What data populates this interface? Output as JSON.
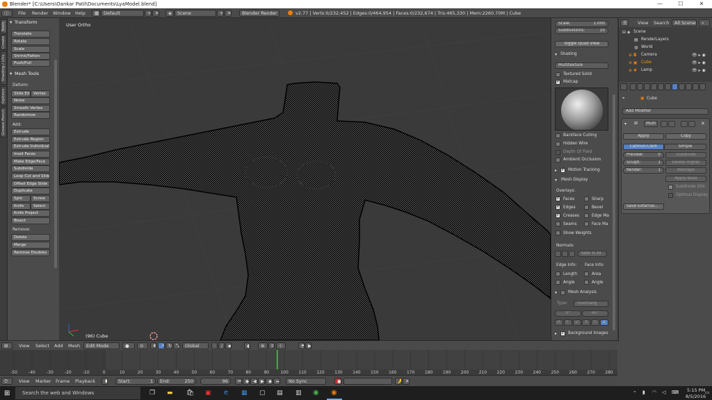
{
  "window": {
    "title": "Blender* [C:\\Users\\Oankar Patil\\Documents\\LyaModel.blend]"
  },
  "menu": {
    "items": [
      "File",
      "Render",
      "Window",
      "Help"
    ]
  },
  "header": {
    "layout": "Default",
    "scene": "Scene",
    "engine": "Blender Render",
    "stats": "v2.77 | Verts:0/232,452 | Edges:0/464,954 | Faces:0/232,674 | Tris:465,330 | Mem:2260.70M | Cube"
  },
  "tool_tabs": [
    "Tools",
    "Create",
    "Shading / UVs",
    "Options",
    "Grease Pencil"
  ],
  "toolshelf": {
    "transform": {
      "title": "Transform",
      "buttons": [
        "Translate",
        "Rotate",
        "Scale",
        "Shrink/Fatten",
        "Push/Pull"
      ]
    },
    "mesh_tools": {
      "title": "Mesh Tools",
      "deform_label": "Deform:",
      "deform": [
        "Slide Ed",
        "Vertex",
        "Noise",
        "Smooth Vertex",
        "Randomize"
      ],
      "add_label": "Add:",
      "add": [
        "Extrude",
        "Extrude Region",
        "Extrude Individual",
        "Inset Faces",
        "Make Edge/Face",
        "Subdivide",
        "Loop Cut and Slide",
        "Offset Edge Slide",
        "Duplicate",
        "Spin",
        "Screw",
        "Knife",
        "Select",
        "Knife Project",
        "Bisect"
      ],
      "remove_label": "Remove:",
      "remove": [
        "Delete",
        "Merge",
        "Remove Doubles"
      ]
    }
  },
  "viewport": {
    "view_label": "User Ortho",
    "object_label": "(96) Cube"
  },
  "npanel": {
    "scale_label": "Scale:",
    "scale_value": "1.000",
    "subdiv_label": "Subdivisions:",
    "subdiv_value": "10",
    "quad_view": "Toggle Quad View",
    "shading_title": "Shading",
    "shading_mode": "Multitexture",
    "textured_solid": "Textured Solid",
    "matcap": "Matcap",
    "backface_culling": "Backface Culling",
    "hidden_wire": "Hidden Wire",
    "depth_of_field": "Depth Of Field",
    "ambient_occlusion": "Ambient Occlusion",
    "motion_tracking": "Motion Tracking",
    "mesh_display_title": "Mesh Display",
    "overlays_label": "Overlays:",
    "overlays": [
      "Faces",
      "Sharp",
      "Edges",
      "Bevel",
      "Creases",
      "Edge Ma",
      "Seams",
      "Face Ma"
    ],
    "show_weights": "Show Weights",
    "normals_label": "Normals:",
    "normal_size": "Size: 0.10",
    "edge_info_label": "Edge Info:",
    "face_info_label": "Face Info:",
    "edge_info": [
      "Length",
      "Angle"
    ],
    "face_info": [
      "Area",
      "Angle"
    ],
    "mesh_analysis": "Mesh Analysis",
    "type_label": "Type:",
    "type_value": "Overhang",
    "angle_min": "0°",
    "angle_max": "45°",
    "axes": [
      "-X",
      "-Y",
      "-Z",
      "X",
      "Y",
      "Z"
    ],
    "background_images": "Background Images"
  },
  "outliner": {
    "menu": [
      "View",
      "Search",
      "All Scenes"
    ],
    "items": [
      "Scene",
      "RenderLayers",
      "World",
      "Camera",
      "Cube",
      "Lamp"
    ]
  },
  "properties": {
    "object": "Cube",
    "add_modifier": "Add Modifier",
    "modifier_name": "Multi",
    "apply": "Apply",
    "copy": "Copy",
    "catmull": "Catmull-Clark",
    "simple": "Simple",
    "preview_label": "Preview:",
    "preview_value": "0",
    "sculpt_label": "Sculpt:",
    "sculpt_value": "1",
    "render_label": "Render:",
    "render_value": "1",
    "right_buttons": [
      "Subdivide",
      "Delete Higher",
      "Reshape",
      "Apply Base"
    ],
    "subdivide_uvs": "Subdivide UVs",
    "optimal_display": "Optimal Display",
    "save_external": "Save External..."
  },
  "bottom_header": {
    "menu": [
      "View",
      "Select",
      "Add",
      "Mesh"
    ],
    "mode": "Edit Mode",
    "orientation": "Global"
  },
  "timeline": {
    "ticks": [
      "-50",
      "-40",
      "-30",
      "-20",
      "-10",
      "0",
      "10",
      "20",
      "30",
      "40",
      "50",
      "60",
      "70",
      "80",
      "90",
      "100",
      "110",
      "120",
      "130",
      "140",
      "150",
      "160",
      "170",
      "180",
      "190",
      "200",
      "210",
      "220",
      "230",
      "240",
      "250",
      "260",
      "270",
      "280"
    ],
    "current_frame": 96,
    "menu": [
      "View",
      "Marker",
      "Frame",
      "Playback"
    ],
    "start_label": "Start:",
    "start_value": "1",
    "end_label": "End:",
    "end_value": "250",
    "frame_value": "96",
    "sync": "No Sync"
  },
  "taskbar": {
    "search_placeholder": "Search the web and Windows",
    "time": "5:15 PM",
    "date": "8/5/2016"
  }
}
